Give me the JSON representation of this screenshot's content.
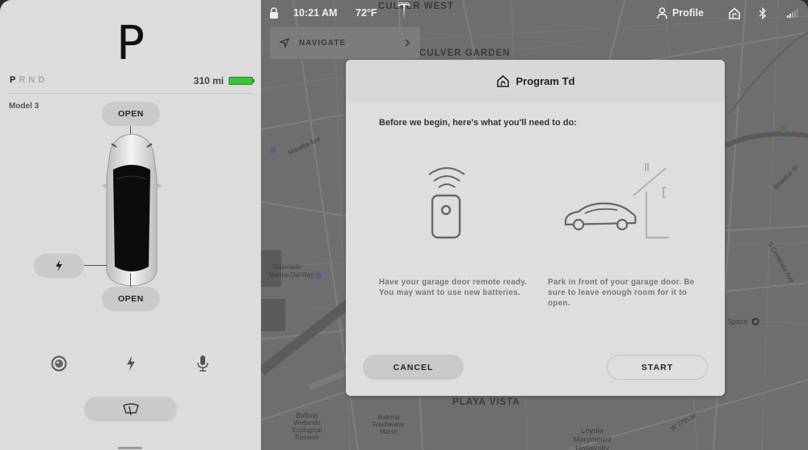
{
  "drive": {
    "current_gear": "P",
    "gears": [
      "P",
      "R",
      "N",
      "D"
    ],
    "active_gear_index": 0,
    "range": "310 mi",
    "battery_level_pct": 90,
    "battery_color": "#3cc33c",
    "model_name": "Model 3",
    "frunk_label": "OPEN",
    "trunk_label": "OPEN",
    "charge_port_icon": "bolt-icon",
    "bottom_icons": [
      "camera-icon",
      "bolt-icon",
      "microphone-icon"
    ],
    "wiper_icon": "wiper-icon"
  },
  "status_bar": {
    "lock_icon": "lock-icon",
    "time": "10:21 AM",
    "temperature": "72°F",
    "logo": "tesla-logo",
    "profile_label": "Profile",
    "icons": [
      "homelink-icon",
      "bluetooth-icon",
      "signal-icon"
    ]
  },
  "navigate": {
    "label": "NAVIGATE",
    "icon": "navigate-arrow-icon"
  },
  "map": {
    "labels": {
      "culver_west": "CULVER WEST",
      "culver_garden": "CULVER GARDEN",
      "playa_vista": "PLAYA VISTA",
      "waterside": "Waterside",
      "marina_del_rey": "Marina Del Rey",
      "maxella_ave": "Maxella Ave",
      "ballona_wetlands": "Ballona Wetlands Ecological Reserve",
      "ballona_marsh": "Ballona Freshwater Marsh",
      "loyola": "Loyola Marymount University",
      "space": "Space",
      "w_77th_st": "W 77th St",
      "beatrice_st": "Beatrice St",
      "centinela": "S Centinela Ave"
    }
  },
  "dialog": {
    "title": "Program Td",
    "title_icon": "homelink-icon",
    "intro": "Before we begin, here's what you'll need to do:",
    "steps": [
      {
        "icon": "garage-remote-icon",
        "text": "Have your garage door remote ready. You may want to use new batteries."
      },
      {
        "icon": "car-garage-icon",
        "text": "Park in front of your garage door. Be sure to leave enough room for it to open."
      }
    ],
    "cancel_label": "CANCEL",
    "start_label": "START"
  }
}
